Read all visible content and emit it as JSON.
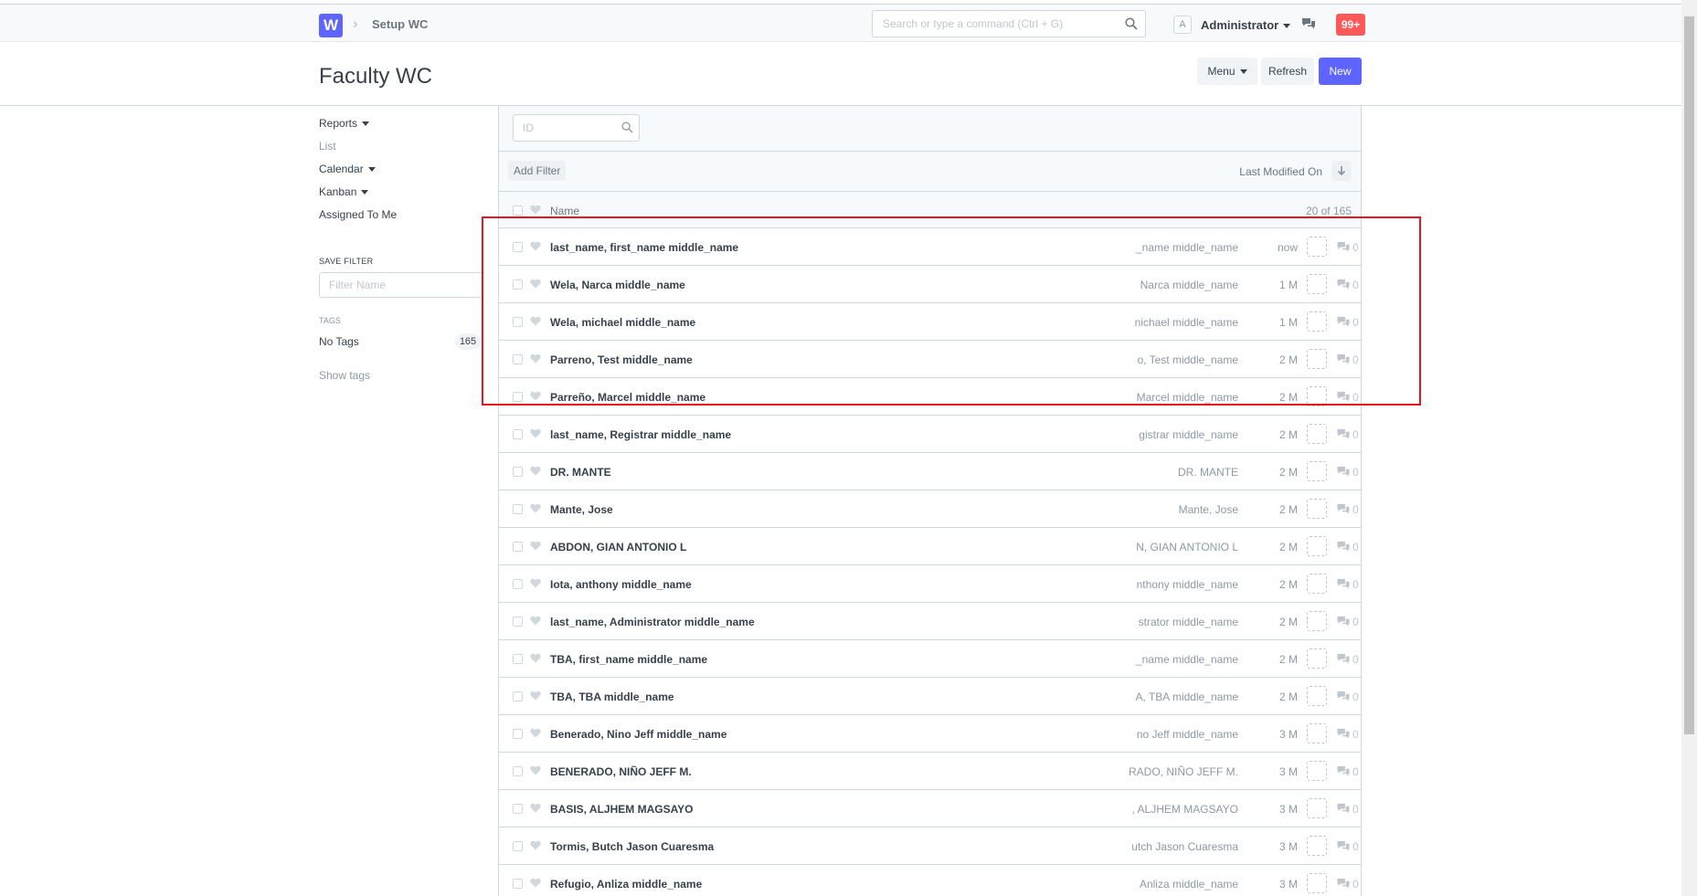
{
  "navbar": {
    "logo_letter": "W",
    "breadcrumb": "Setup WC",
    "search_placeholder": "Search or type a command (Ctrl + G)",
    "avatar_letter": "A",
    "user": "Administrator",
    "notifications": "99+"
  },
  "page": {
    "title": "Faculty WC",
    "buttons": {
      "menu": "Menu",
      "refresh": "Refresh",
      "new": "New"
    }
  },
  "sidebar": {
    "items": [
      {
        "label": "Reports",
        "dropdown": true
      },
      {
        "label": "List",
        "dropdown": false
      },
      {
        "label": "Calendar",
        "dropdown": true
      },
      {
        "label": "Kanban",
        "dropdown": true
      },
      {
        "label": "Assigned To Me",
        "dropdown": false
      }
    ],
    "save_filter_label": "SAVE FILTER",
    "filter_name_placeholder": "Filter Name",
    "tags_label": "TAGS",
    "no_tags": "No Tags",
    "no_tags_count": "165",
    "show_tags": "Show tags"
  },
  "list": {
    "id_placeholder": "ID",
    "add_filter": "Add Filter",
    "sort_label": "Last Modified On",
    "header_name": "Name",
    "count": "20 of 165",
    "rows": [
      {
        "title": "last_name, first_name middle_name",
        "sub": "_name middle_name",
        "time": "now",
        "comments": "0"
      },
      {
        "title": "Wela, Narca middle_name",
        "sub": "Narca middle_name",
        "time": "1 M",
        "comments": "0"
      },
      {
        "title": "Wela, michael middle_name",
        "sub": "nichael middle_name",
        "time": "1 M",
        "comments": "0"
      },
      {
        "title": "Parreno, Test middle_name",
        "sub": "o, Test middle_name",
        "time": "2 M",
        "comments": "0"
      },
      {
        "title": "Parreño, Marcel middle_name",
        "sub": "Marcel middle_name",
        "time": "2 M",
        "comments": "0"
      },
      {
        "title": "last_name, Registrar middle_name",
        "sub": "gistrar middle_name",
        "time": "2 M",
        "comments": "0"
      },
      {
        "title": "DR. MANTE",
        "sub": "DR. MANTE",
        "time": "2 M",
        "comments": "0"
      },
      {
        "title": "Mante, Jose",
        "sub": "Mante, Jose",
        "time": "2 M",
        "comments": "0"
      },
      {
        "title": "ABDON, GIAN ANTONIO L",
        "sub": "N, GIAN ANTONIO L",
        "time": "2 M",
        "comments": "0"
      },
      {
        "title": "Iota, anthony middle_name",
        "sub": "nthony middle_name",
        "time": "2 M",
        "comments": "0"
      },
      {
        "title": "last_name, Administrator middle_name",
        "sub": "strator middle_name",
        "time": "2 M",
        "comments": "0"
      },
      {
        "title": "TBA, first_name middle_name",
        "sub": "_name middle_name",
        "time": "2 M",
        "comments": "0"
      },
      {
        "title": "TBA, TBA middle_name",
        "sub": "A, TBA middle_name",
        "time": "2 M",
        "comments": "0"
      },
      {
        "title": "Benerado, Nino Jeff middle_name",
        "sub": "no Jeff middle_name",
        "time": "3 M",
        "comments": "0"
      },
      {
        "title": "BENERADO, NIÑO JEFF M.",
        "sub": "RADO, NIÑO JEFF M.",
        "time": "3 M",
        "comments": "0"
      },
      {
        "title": "BASIS, ALJHEM MAGSAYO",
        "sub": ", ALJHEM MAGSAYO",
        "time": "3 M",
        "comments": "0"
      },
      {
        "title": "Tormis, Butch Jason Cuaresma",
        "sub": "utch Jason Cuaresma",
        "time": "3 M",
        "comments": "0"
      },
      {
        "title": "Refugio, Anliza middle_name",
        "sub": "Anliza middle_name",
        "time": "3 M",
        "comments": "0"
      }
    ]
  },
  "colors": {
    "accent": "#5e64ff",
    "notification": "#ff5858",
    "highlight_box": "#e8151c"
  }
}
